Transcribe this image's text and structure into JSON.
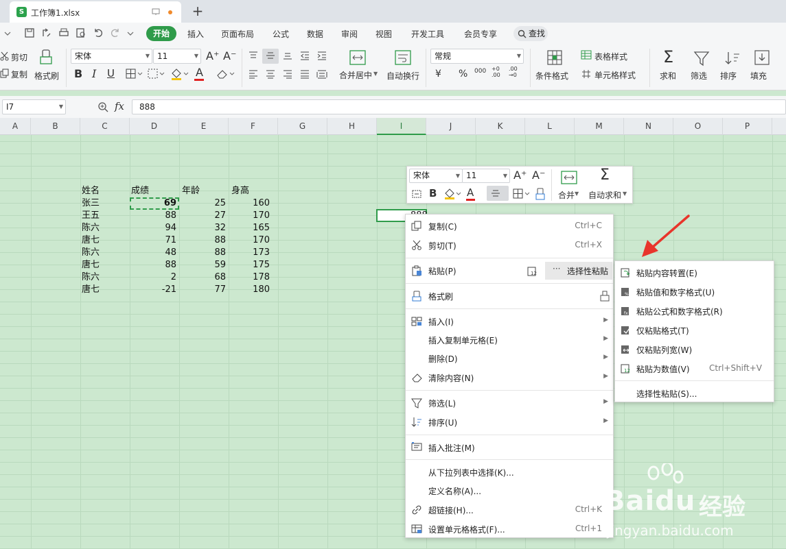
{
  "title_bar": {
    "file_tab": "工作簿1.xlsx",
    "logo_letter": "S",
    "new_tab": "+"
  },
  "menu": {
    "items": [
      "开始",
      "插入",
      "页面布局",
      "公式",
      "数据",
      "审阅",
      "视图",
      "开发工具",
      "会员专享"
    ],
    "search": "查找"
  },
  "ribbon": {
    "cut": "剪切",
    "copy": "复制",
    "format_painter": "格式刷",
    "font_name": "宋体",
    "font_size": "11",
    "merge_center": "合并居中",
    "wrap_text": "自动换行",
    "number_format": "常规",
    "currency": "¥",
    "percent": "%",
    "thousands": "000",
    "inc_decimal": "+0 .00",
    "dec_decimal": ".00 →0",
    "conditional_format": "条件格式",
    "table_style": "表格样式",
    "cell_style": "单元格样式",
    "sum": "求和",
    "filter": "筛选",
    "sort": "排序",
    "fill": "填充",
    "bold": "B",
    "italic": "I",
    "underline": "U",
    "font_color": "A"
  },
  "formula_bar": {
    "cell_ref": "I7",
    "fx": "fx",
    "value": "888"
  },
  "columns": [
    "A",
    "B",
    "C",
    "D",
    "E",
    "F",
    "G",
    "H",
    "I",
    "J",
    "K",
    "L",
    "M",
    "N",
    "O",
    "P"
  ],
  "selected_column": "I",
  "table": {
    "headers": [
      "姓名",
      "成绩",
      "年龄",
      "身高"
    ],
    "rows": [
      [
        "张三",
        "69",
        "25",
        "160"
      ],
      [
        "王五",
        "88",
        "27",
        "170"
      ],
      [
        "陈六",
        "94",
        "32",
        "165"
      ],
      [
        "唐七",
        "71",
        "88",
        "170"
      ],
      [
        "陈六",
        "48",
        "88",
        "173"
      ],
      [
        "唐七",
        "88",
        "59",
        "175"
      ],
      [
        "陈六",
        "2",
        "68",
        "178"
      ],
      [
        "唐七",
        "-21",
        "77",
        "180"
      ]
    ]
  },
  "active_cell_text": "888",
  "mini_toolbar": {
    "font_name": "宋体",
    "font_size": "11",
    "bold": "B",
    "font_color": "A",
    "merge": "合并",
    "autosum": "自动求和"
  },
  "context_menu": {
    "copy": {
      "label": "复制(C)",
      "shortcut": "Ctrl+C"
    },
    "cut": {
      "label": "剪切(T)",
      "shortcut": "Ctrl+X"
    },
    "paste": {
      "label": "粘贴(P)"
    },
    "paste_special_btn": "选择性粘贴",
    "format_painter": {
      "label": "格式刷"
    },
    "insert": {
      "label": "插入(I)"
    },
    "insert_copied": {
      "label": "插入复制单元格(E)"
    },
    "delete": {
      "label": "删除(D)"
    },
    "clear": {
      "label": "清除内容(N)"
    },
    "filter": {
      "label": "筛选(L)"
    },
    "sort": {
      "label": "排序(U)"
    },
    "insert_comment": {
      "label": "插入批注(M)"
    },
    "pick_from_list": {
      "label": "从下拉列表中选择(K)..."
    },
    "define_name": {
      "label": "定义名称(A)..."
    },
    "hyperlink": {
      "label": "超链接(H)...",
      "shortcut": "Ctrl+K"
    },
    "format_cells": {
      "label": "设置单元格格式(F)...",
      "shortcut": "Ctrl+1"
    }
  },
  "submenu": {
    "transpose": "粘贴内容转置(E)",
    "values_numfmt": "粘贴值和数字格式(U)",
    "formulas_numfmt": "粘贴公式和数字格式(R)",
    "formats_only": "仅粘贴格式(T)",
    "col_widths": "仅粘贴列宽(W)",
    "values": "粘贴为数值(V)",
    "values_shortcut": "Ctrl+Shift+V",
    "paste_special": "选择性粘贴(S)..."
  },
  "watermark": {
    "brand": "Baidu",
    "brand2": "经验",
    "url": "jingyan.baidu.com"
  },
  "colors": {
    "accent": "#2f9b4a",
    "grid_bg": "#cce8cf",
    "arrow": "#e8352b"
  }
}
